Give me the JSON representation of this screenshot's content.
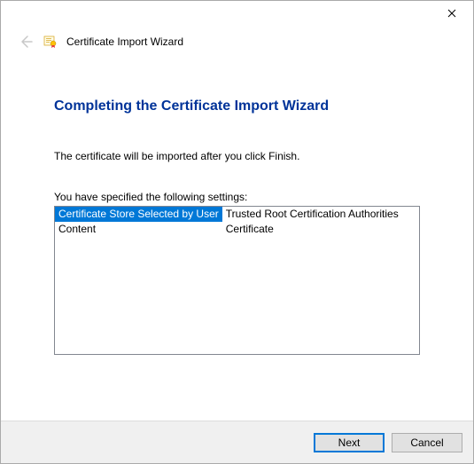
{
  "wizard": {
    "name": "Certificate Import Wizard"
  },
  "page": {
    "heading": "Completing the Certificate Import Wizard",
    "description": "The certificate will be imported after you click Finish.",
    "settings_label": "You have specified the following settings:",
    "settings": [
      {
        "key": "Certificate Store Selected by User",
        "value": "Trusted Root Certification Authorities"
      },
      {
        "key": "Content",
        "value": "Certificate"
      }
    ]
  },
  "buttons": {
    "next": "Next",
    "cancel": "Cancel"
  }
}
